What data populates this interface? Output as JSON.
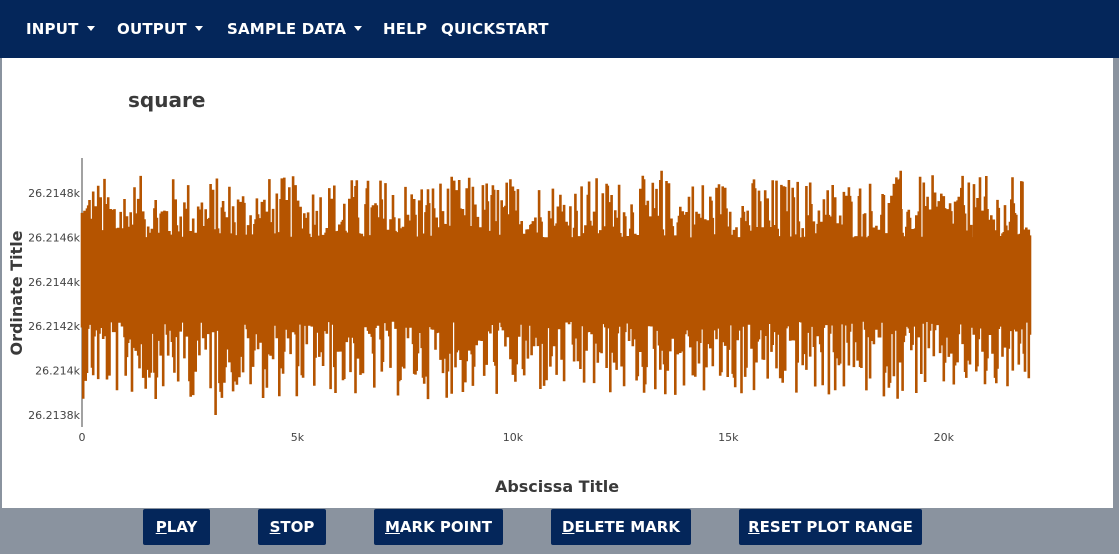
{
  "navbar": {
    "items": [
      {
        "label": "INPUT",
        "dropdown": true
      },
      {
        "label": "OUTPUT",
        "dropdown": true
      },
      {
        "label": "SAMPLE DATA",
        "dropdown": true
      },
      {
        "label": "HELP",
        "dropdown": false
      },
      {
        "label": "QUICKSTART",
        "dropdown": false
      }
    ],
    "background": "#04265a"
  },
  "chart_data": {
    "type": "line",
    "title": "square",
    "xlabel": "Abscissa Title",
    "ylabel": "Ordinate Title",
    "xlim": [
      0,
      22000
    ],
    "ylim": [
      26213.75,
      26214.95
    ],
    "x_ticks": [
      0,
      5000,
      10000,
      15000,
      20000
    ],
    "x_tick_labels": [
      "0",
      "5k",
      "10k",
      "15k",
      "20k"
    ],
    "y_ticks": [
      26213.8,
      26214.0,
      26214.2,
      26214.4,
      26214.6,
      26214.8
    ],
    "y_tick_labels": [
      "26.2138k",
      "26.214k",
      "26.2142k",
      "26.2144k",
      "26.2146k",
      "26.2148k"
    ],
    "series": [
      {
        "color": "#b55400",
        "description": "dense square-wave noise ~22000 samples",
        "x_range": [
          0,
          22000
        ],
        "y_core": [
          26214.25,
          26214.55
        ],
        "y_min": 26213.8,
        "y_max": 26214.9
      }
    ],
    "grid": false
  },
  "buttons": {
    "play": {
      "underline": "P",
      "rest": "LAY"
    },
    "stop": {
      "underline": "S",
      "rest": "TOP"
    },
    "mark_point": {
      "underline": "M",
      "rest": "ARK POINT"
    },
    "delete_mark": {
      "underline": "D",
      "rest": "ELETE MARK"
    },
    "reset_plot_range": {
      "underline": "R",
      "rest": "ESET PLOT RANGE"
    }
  }
}
